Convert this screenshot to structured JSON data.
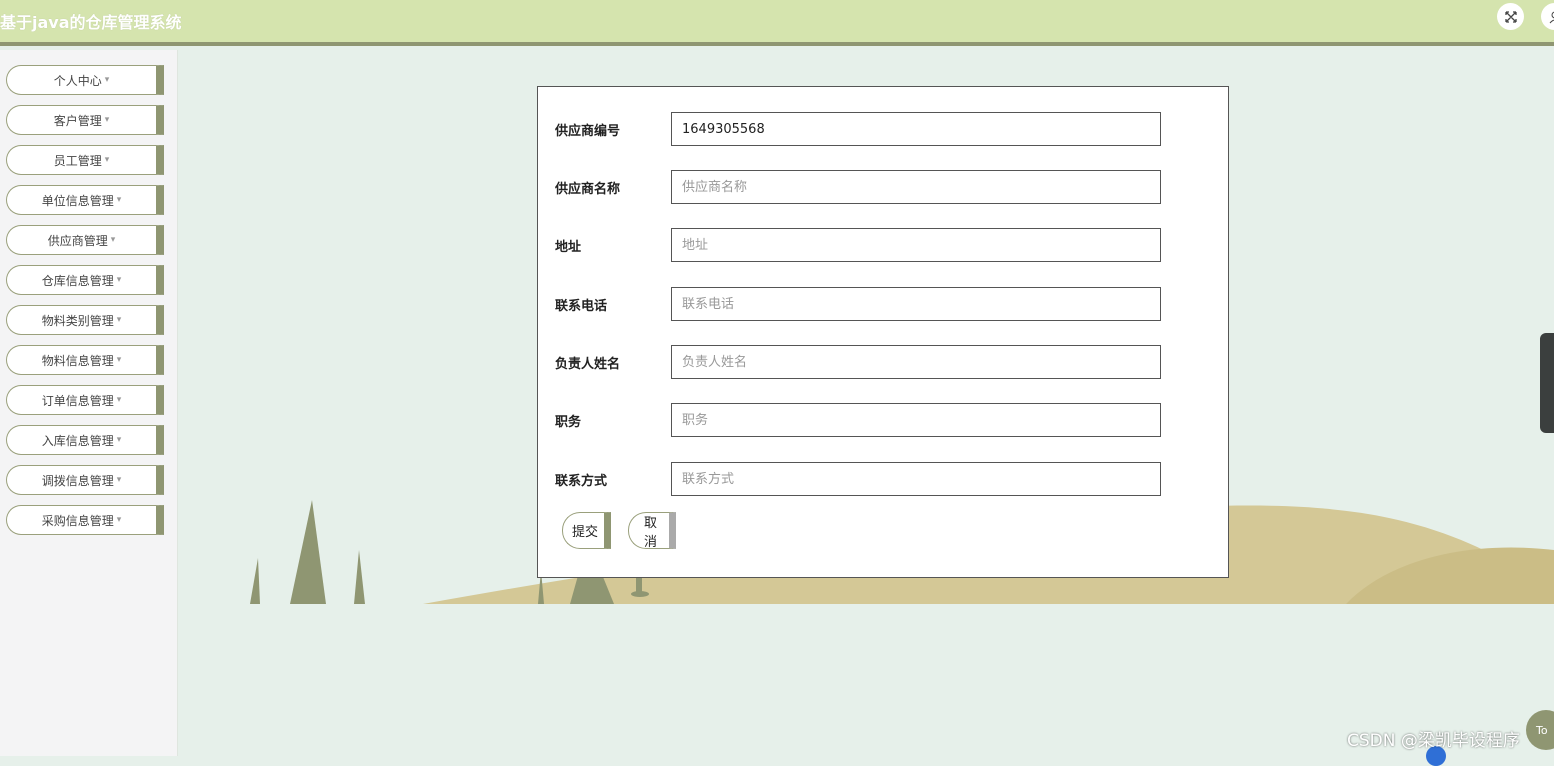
{
  "header": {
    "title": "基于java的仓库管理系统",
    "fullscreen_icon": "fullscreen-exit-icon",
    "user_icon": "user-icon"
  },
  "sidebar": {
    "items": [
      {
        "label": "个人中心"
      },
      {
        "label": "客户管理"
      },
      {
        "label": "员工管理"
      },
      {
        "label": "单位信息管理"
      },
      {
        "label": "供应商管理"
      },
      {
        "label": "仓库信息管理"
      },
      {
        "label": "物料类别管理"
      },
      {
        "label": "物料信息管理"
      },
      {
        "label": "订单信息管理"
      },
      {
        "label": "入库信息管理"
      },
      {
        "label": "调拨信息管理"
      },
      {
        "label": "采购信息管理"
      }
    ],
    "caret": "▾"
  },
  "form": {
    "fields": [
      {
        "label": "供应商编号",
        "value": "1649305568",
        "placeholder": ""
      },
      {
        "label": "供应商名称",
        "value": "",
        "placeholder": "供应商名称"
      },
      {
        "label": "地址",
        "value": "",
        "placeholder": "地址"
      },
      {
        "label": "联系电话",
        "value": "",
        "placeholder": "联系电话"
      },
      {
        "label": "负责人姓名",
        "value": "",
        "placeholder": "负责人姓名"
      },
      {
        "label": "职务",
        "value": "",
        "placeholder": "职务"
      },
      {
        "label": "联系方式",
        "value": "",
        "placeholder": "联系方式"
      }
    ],
    "submit_label": "提交",
    "cancel_label": "取消"
  },
  "floating": {
    "top_label": "To"
  },
  "watermark": "CSDN @梁凯毕设程序",
  "colors": {
    "header_bg": "#d5e4ae",
    "accent": "#8f9672",
    "page_bg": "#e6f0ea",
    "hill": "#d4c896"
  }
}
